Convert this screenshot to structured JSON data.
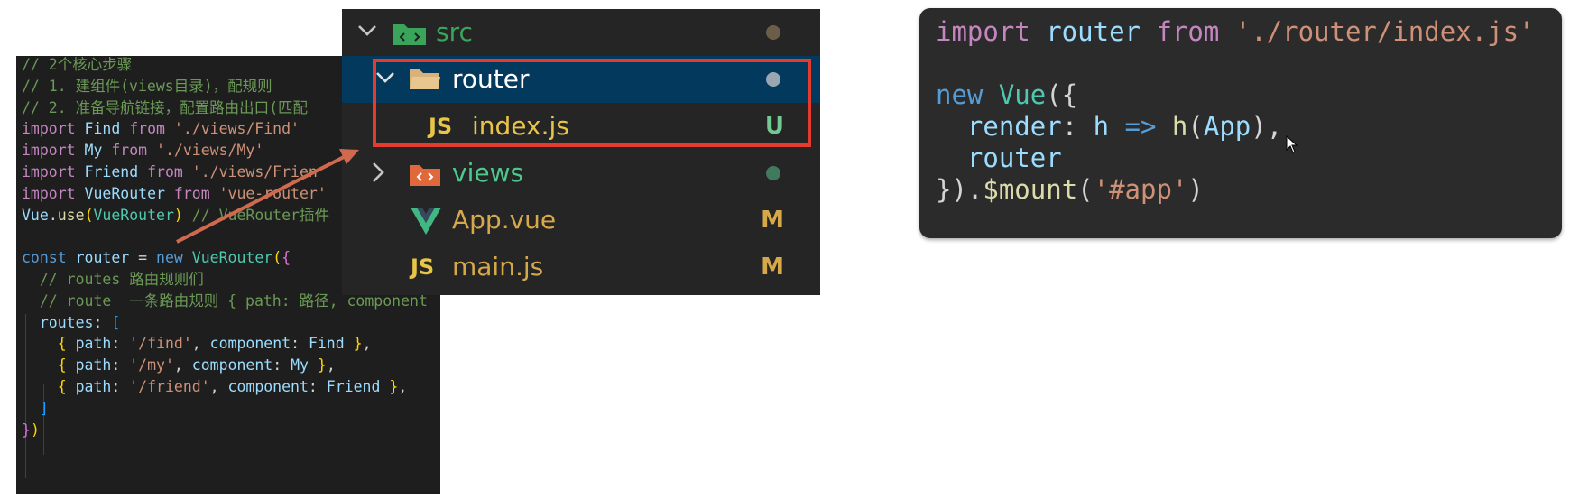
{
  "left_code": {
    "lines": [
      [
        {
          "t": "// 2个核心步骤",
          "c": "c-com"
        }
      ],
      [
        {
          "t": "// 1. 建组件(views目录)，配规则",
          "c": "c-com"
        }
      ],
      [
        {
          "t": "// 2. 准备导航链接，配置路由出口(匹配",
          "c": "c-com"
        }
      ],
      [
        {
          "t": "import",
          "c": "c-kw"
        },
        {
          "t": " Find ",
          "c": "c-id"
        },
        {
          "t": "from",
          "c": "c-kw"
        },
        {
          "t": " './views/Find'",
          "c": "c-str"
        }
      ],
      [
        {
          "t": "import",
          "c": "c-kw"
        },
        {
          "t": " My ",
          "c": "c-id"
        },
        {
          "t": "from",
          "c": "c-kw"
        },
        {
          "t": " './views/My'",
          "c": "c-str"
        }
      ],
      [
        {
          "t": "import",
          "c": "c-kw"
        },
        {
          "t": " Friend ",
          "c": "c-id"
        },
        {
          "t": "from",
          "c": "c-kw"
        },
        {
          "t": " './views/Frien",
          "c": "c-str"
        }
      ],
      [
        {
          "t": "import",
          "c": "c-kw"
        },
        {
          "t": " VueRouter ",
          "c": "c-id"
        },
        {
          "t": "from",
          "c": "c-kw"
        },
        {
          "t": " 'vue-router'",
          "c": "c-str"
        }
      ],
      [
        {
          "t": "Vue",
          "c": "c-id"
        },
        {
          "t": ".",
          "c": "c-txt"
        },
        {
          "t": "use",
          "c": "c-fn"
        },
        {
          "t": "(",
          "c": "c-b1"
        },
        {
          "t": "VueRouter",
          "c": "c-cls"
        },
        {
          "t": ")",
          "c": "c-b1"
        },
        {
          "t": " // VueRouter插件",
          "c": "c-com"
        }
      ],
      [
        {
          "t": "",
          "c": "c-txt"
        }
      ],
      [
        {
          "t": "const",
          "c": "c-kw2"
        },
        {
          "t": " router ",
          "c": "c-id"
        },
        {
          "t": "= ",
          "c": "c-txt"
        },
        {
          "t": "new",
          "c": "c-kw2"
        },
        {
          "t": " VueRouter",
          "c": "c-cls"
        },
        {
          "t": "(",
          "c": "c-b1"
        },
        {
          "t": "{",
          "c": "c-b2"
        }
      ],
      [
        {
          "t": "  // routes 路由规则们",
          "c": "c-com"
        }
      ],
      [
        {
          "t": "  // route  一条路由规则 { path: 路径, component",
          "c": "c-com"
        }
      ],
      [
        {
          "t": "  routes",
          "c": "c-id"
        },
        {
          "t": ": ",
          "c": "c-txt"
        },
        {
          "t": "[",
          "c": "c-b3"
        }
      ],
      [
        {
          "t": "    { ",
          "c": "c-b1"
        },
        {
          "t": "path",
          "c": "c-id"
        },
        {
          "t": ": ",
          "c": "c-txt"
        },
        {
          "t": "'/find'",
          "c": "c-str"
        },
        {
          "t": ", ",
          "c": "c-txt"
        },
        {
          "t": "component",
          "c": "c-id"
        },
        {
          "t": ": ",
          "c": "c-txt"
        },
        {
          "t": "Find",
          "c": "c-id"
        },
        {
          "t": " }",
          "c": "c-b1"
        },
        {
          "t": ",",
          "c": "c-txt"
        }
      ],
      [
        {
          "t": "    { ",
          "c": "c-b1"
        },
        {
          "t": "path",
          "c": "c-id"
        },
        {
          "t": ": ",
          "c": "c-txt"
        },
        {
          "t": "'/my'",
          "c": "c-str"
        },
        {
          "t": ", ",
          "c": "c-txt"
        },
        {
          "t": "component",
          "c": "c-id"
        },
        {
          "t": ": ",
          "c": "c-txt"
        },
        {
          "t": "My",
          "c": "c-id"
        },
        {
          "t": " }",
          "c": "c-b1"
        },
        {
          "t": ",",
          "c": "c-txt"
        }
      ],
      [
        {
          "t": "    { ",
          "c": "c-b1"
        },
        {
          "t": "path",
          "c": "c-id"
        },
        {
          "t": ": ",
          "c": "c-txt"
        },
        {
          "t": "'/friend'",
          "c": "c-str"
        },
        {
          "t": ", ",
          "c": "c-txt"
        },
        {
          "t": "component",
          "c": "c-id"
        },
        {
          "t": ": ",
          "c": "c-txt"
        },
        {
          "t": "Friend",
          "c": "c-id"
        },
        {
          "t": " }",
          "c": "c-b1"
        },
        {
          "t": ",",
          "c": "c-txt"
        }
      ],
      [
        {
          "t": "  ]",
          "c": "c-b3"
        }
      ],
      [
        {
          "t": "}",
          "c": "c-b2"
        },
        {
          "t": ")",
          "c": "c-b1"
        }
      ]
    ]
  },
  "explorer": {
    "src": {
      "label": "src",
      "dot_color": "#6b5d4a"
    },
    "router": {
      "label": "router",
      "dot_color": "#9aa7b3"
    },
    "index": {
      "icon": "JS",
      "label": "index.js",
      "badge": "U",
      "badge_color": "#73c991"
    },
    "views": {
      "label": "views",
      "dot_color": "#3f7a5e"
    },
    "app": {
      "label": "App.vue",
      "badge": "M",
      "badge_color": "#d7a84a"
    },
    "main": {
      "icon": "JS",
      "label": "main.js",
      "badge": "M",
      "badge_color": "#d7a84a"
    }
  },
  "right_code": {
    "lines": [
      [
        {
          "t": "import",
          "c": "k-pur"
        },
        {
          "t": " router ",
          "c": "k-id"
        },
        {
          "t": "from",
          "c": "k-pur"
        },
        {
          "t": " './router/index.js'",
          "c": "k-str"
        }
      ],
      [
        {
          "t": "",
          "c": "k-txt"
        }
      ],
      [
        {
          "t": "new",
          "c": "k-blu"
        },
        {
          "t": " Vue",
          "c": "k-cls"
        },
        {
          "t": "({",
          "c": "k-txt"
        }
      ],
      [
        {
          "t": "  render",
          "c": "k-id"
        },
        {
          "t": ": ",
          "c": "k-txt"
        },
        {
          "t": "h",
          "c": "k-id"
        },
        {
          "t": " => ",
          "c": "k-blu"
        },
        {
          "t": "h",
          "c": "k-fn"
        },
        {
          "t": "(",
          "c": "k-txt"
        },
        {
          "t": "App",
          "c": "k-id"
        },
        {
          "t": "),",
          "c": "k-txt"
        }
      ],
      [
        {
          "t": "  router",
          "c": "k-id"
        }
      ],
      [
        {
          "t": "}).",
          "c": "k-txt"
        },
        {
          "t": "$mount",
          "c": "k-fn"
        },
        {
          "t": "(",
          "c": "k-txt"
        },
        {
          "t": "'#app'",
          "c": "k-str"
        },
        {
          "t": ")",
          "c": "k-txt"
        }
      ]
    ]
  },
  "colors": {
    "highlight_border": "#e53b2f",
    "arrow": "#d06a4f",
    "folder_src": "#3aa55a",
    "folder_router": "#d9b27a",
    "folder_views": "#e0683a",
    "vue_logo": "#41b883"
  }
}
